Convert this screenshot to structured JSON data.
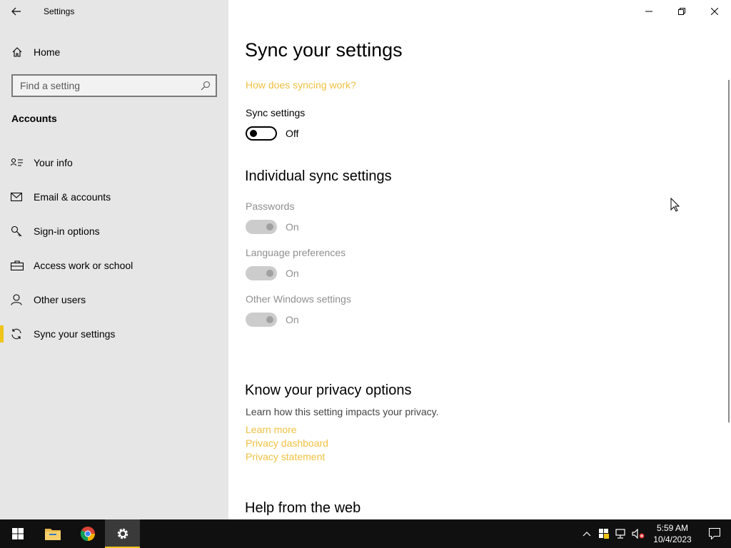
{
  "window": {
    "title": "Settings"
  },
  "sidebar": {
    "home_label": "Home",
    "search_placeholder": "Find a setting",
    "section": "Accounts",
    "items": [
      {
        "label": "Your info",
        "icon": "person-card-icon"
      },
      {
        "label": "Email & accounts",
        "icon": "envelope-icon"
      },
      {
        "label": "Sign-in options",
        "icon": "key-icon"
      },
      {
        "label": "Access work or school",
        "icon": "briefcase-icon"
      },
      {
        "label": "Other users",
        "icon": "person-icon"
      },
      {
        "label": "Sync your settings",
        "icon": "sync-icon",
        "active": true
      }
    ]
  },
  "main": {
    "title": "Sync your settings",
    "how_link": "How does syncing work?",
    "sync_label": "Sync settings",
    "sync_state": "Off",
    "individual_title": "Individual sync settings",
    "individual": [
      {
        "label": "Passwords",
        "state": "On"
      },
      {
        "label": "Language preferences",
        "state": "On"
      },
      {
        "label": "Other Windows settings",
        "state": "On"
      }
    ],
    "privacy_title": "Know your privacy options",
    "privacy_desc": "Learn how this setting impacts your privacy.",
    "privacy_links": [
      "Learn more",
      "Privacy dashboard",
      "Privacy statement"
    ],
    "help_title": "Help from the web"
  },
  "taskbar": {
    "time": "5:59 AM",
    "date": "10/4/2023"
  },
  "colors": {
    "accent": "#f0c419",
    "link": "#f0c040",
    "sidebar_bg": "#e6e6e6",
    "taskbar_bg": "#101010"
  }
}
